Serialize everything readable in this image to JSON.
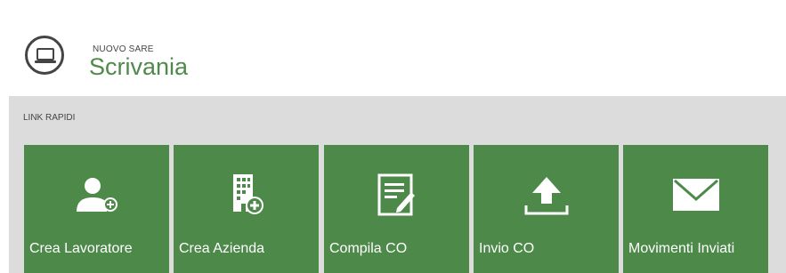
{
  "header": {
    "app_subtitle": "NUOVO SARE",
    "page_title": "Scrivania",
    "logo_icon": "laptop-icon"
  },
  "quick_links": {
    "section_label": "LINK RAPIDI",
    "tile_color": "#4d8a4a",
    "items": [
      {
        "label": "Crea Lavoratore",
        "icon": "add-user-icon"
      },
      {
        "label": "Crea Azienda",
        "icon": "add-building-icon"
      },
      {
        "label": "Compila CO",
        "icon": "edit-document-icon"
      },
      {
        "label": "Invio CO",
        "icon": "upload-icon"
      },
      {
        "label": "Movimenti Inviati",
        "icon": "envelope-icon"
      }
    ]
  }
}
